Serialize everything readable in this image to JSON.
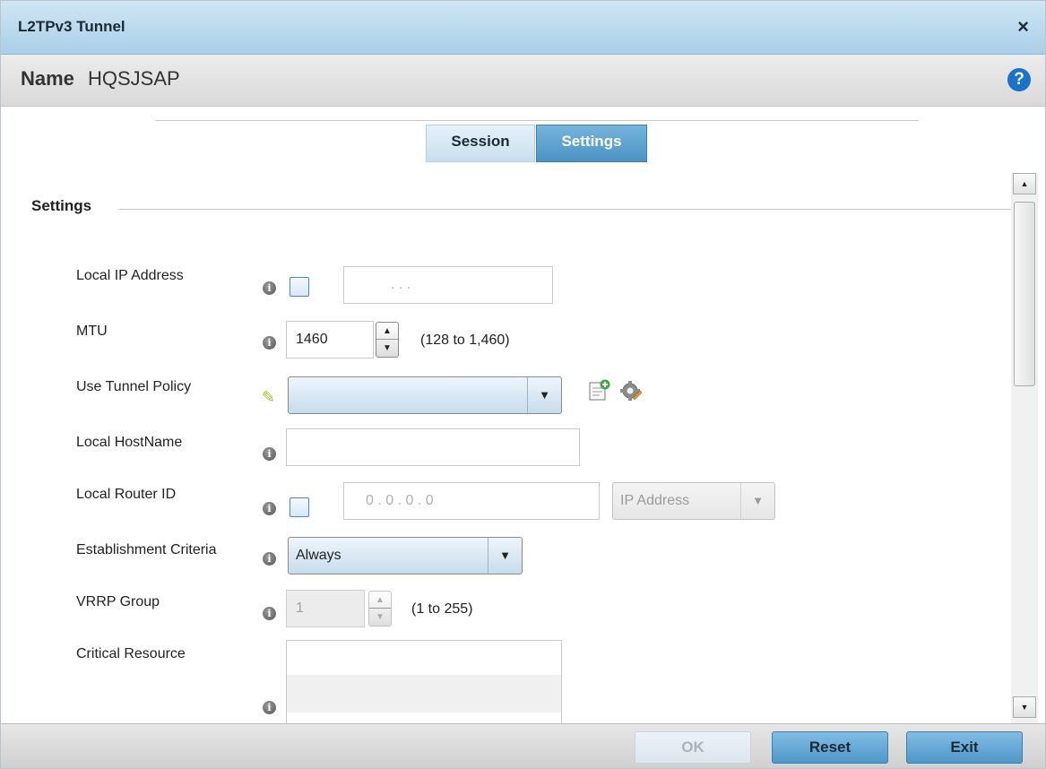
{
  "dialog": {
    "title": "L2TPv3 Tunnel",
    "close_glyph": "×",
    "name_label": "Name",
    "name_value": "HQSJSAP",
    "help_glyph": "?"
  },
  "tabs": [
    {
      "label": "Session",
      "active": false
    },
    {
      "label": "Settings",
      "active": true
    }
  ],
  "section": {
    "title": "Settings"
  },
  "fields": {
    "local_ip": {
      "label": "Local IP Address",
      "checked": false,
      "value": ".   .   ."
    },
    "mtu": {
      "label": "MTU",
      "value": "1460",
      "range": "(128 to 1,460)"
    },
    "tunnel_policy": {
      "label": "Use Tunnel Policy",
      "value": "",
      "icons": [
        "pencil-icon",
        "create-policy-icon",
        "edit-policy-icon"
      ]
    },
    "local_hostname": {
      "label": "Local HostName",
      "value": ""
    },
    "local_router_id": {
      "label": "Local Router ID",
      "checked": false,
      "value": "0  .  0  .  0  .  0",
      "type_value": "IP Address"
    },
    "establishment": {
      "label": "Establishment Criteria",
      "value": "Always"
    },
    "vrrp_group": {
      "label": "VRRP Group",
      "value": "1",
      "range": "(1 to 255)"
    },
    "critical_resource": {
      "label": "Critical Resource"
    }
  },
  "footer": {
    "ok_label": "OK",
    "ok_enabled": false,
    "reset_label": "Reset",
    "exit_label": "Exit"
  },
  "colors": {
    "accent": "#4b93c4",
    "titlebar": "#a9cfe7",
    "help": "#1a73c8"
  }
}
